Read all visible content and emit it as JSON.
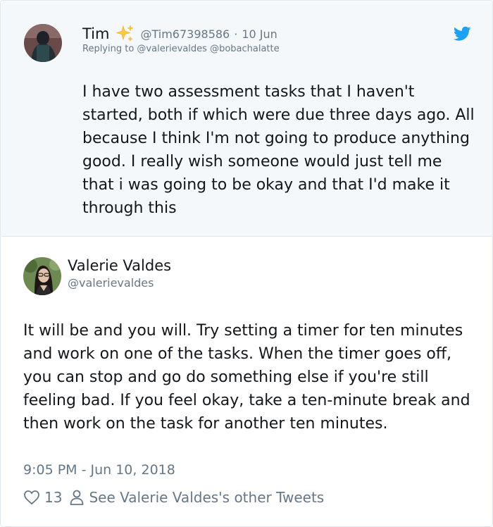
{
  "parent_tweet": {
    "display_name": "Tim",
    "name_emoji": "sparkles-emoji",
    "handle": "@Tim67398586",
    "separator": "·",
    "date": "10 Jun",
    "replying_to": "Replying to @valerievaldes @bobachalatte",
    "text": "I have two assessment tasks that I haven't started, both if which were due three days ago. All because I think I'm not going to produce anything good. I really wish someone would just tell me that i was going to be okay and that I'd make it through this"
  },
  "main_tweet": {
    "display_name": "Valerie Valdes",
    "handle": "@valerievaldes",
    "text": "It will be and you will. Try setting a timer for ten minutes and work on one of the tasks. When the timer goes off, you can stop and go do something else if you're still feeling bad. If you feel okay, take a ten-minute break and then work on the task for another ten minutes.",
    "timestamp": "9:05 PM - Jun 10, 2018",
    "like_count": "13",
    "other_tweets_link": "See Valerie Valdes's other Tweets"
  },
  "icons": {
    "brand": "twitter-bird-icon",
    "like": "heart-icon",
    "profile": "person-icon"
  },
  "colors": {
    "twitter_blue": "#1da1f2",
    "secondary_text": "#657786",
    "primary_text": "#14171a",
    "parent_background": "#f5f8fa",
    "sparkle_yellow": "#ffcc33"
  }
}
